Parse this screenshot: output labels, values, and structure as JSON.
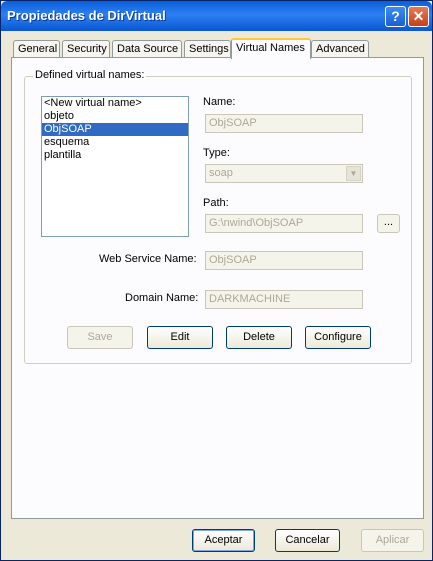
{
  "window": {
    "title": "Propiedades de DirVirtual",
    "help_glyph": "?",
    "close_glyph": "✕"
  },
  "tabs": [
    "General",
    "Security",
    "Data Source",
    "Settings",
    "Virtual Names",
    "Advanced"
  ],
  "active_tab": "Virtual Names",
  "group": {
    "label": "Defined virtual names:"
  },
  "list": {
    "items": [
      "<New virtual name>",
      "objeto",
      "ObjSOAP",
      "esquema",
      "plantilla"
    ],
    "selected": "ObjSOAP"
  },
  "form": {
    "name_label": "Name:",
    "name_value": "ObjSOAP",
    "type_label": "Type:",
    "type_value": "soap",
    "path_label": "Path:",
    "path_value": "G:\\nwind\\ObjSOAP",
    "browse_label": "...",
    "ws_label": "Web Service Name:",
    "ws_value": "ObjSOAP",
    "domain_label": "Domain Name:",
    "domain_value": "DARKMACHINE"
  },
  "actions": {
    "save": "Save",
    "edit": "Edit",
    "delete": "Delete",
    "configure": "Configure"
  },
  "footer": {
    "ok": "Aceptar",
    "cancel": "Cancelar",
    "apply": "Aplicar"
  }
}
